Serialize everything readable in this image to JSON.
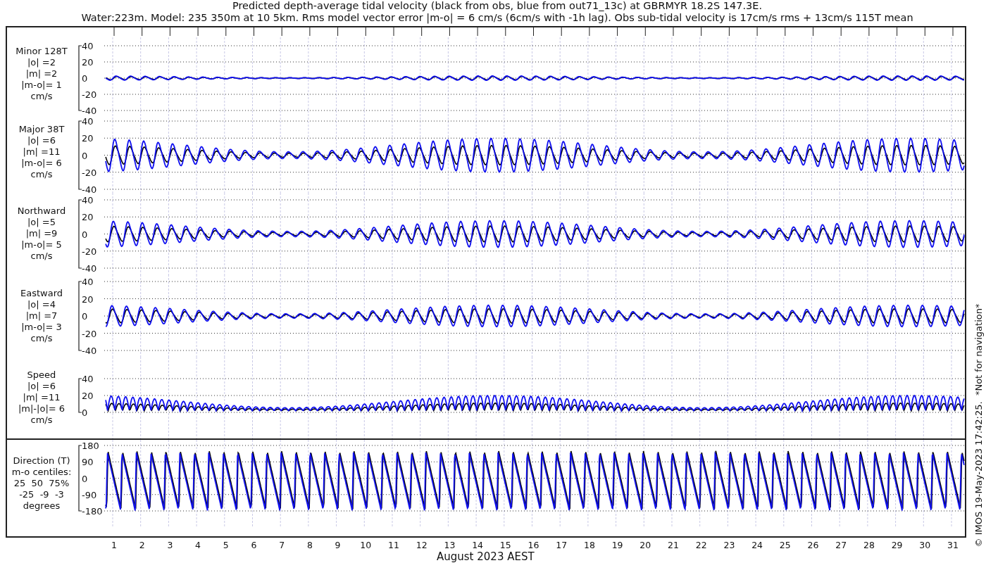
{
  "title_lines": [
    "Predicted depth-average tidal velocity (black from obs, blue from out71_13c) at GBRMYR 18.2S 147.3E.",
    "Water:223m. Model: 235 350m at 10 5km. Rms model vector error |m-o| = 6 cm/s (6cm/s with -1h lag). Obs sub-tidal velocity is 17cm/s rms + 13cm/s 115T mean"
  ],
  "panels": [
    {
      "kind": "velocity",
      "label_lines": [
        "Minor 128T",
        "|o| =2",
        "|m| =2",
        "|m-o|= 1",
        "cm/s"
      ],
      "yticks": [
        "40",
        "20",
        "0",
        "-20",
        "-40"
      ]
    },
    {
      "kind": "velocity",
      "label_lines": [
        "Major 38T",
        "|o| =6",
        "|m| =11",
        "|m-o|= 6",
        "cm/s"
      ],
      "yticks": [
        "40",
        "20",
        "0",
        "-20",
        "-40"
      ]
    },
    {
      "kind": "velocity",
      "label_lines": [
        "Northward",
        "|o| =5",
        "|m| =9",
        "|m-o|= 5",
        "cm/s"
      ],
      "yticks": [
        "40",
        "20",
        "0",
        "-20",
        "-40"
      ]
    },
    {
      "kind": "velocity",
      "label_lines": [
        "Eastward",
        "|o| =4",
        "|m| =7",
        "|m-o|= 3",
        "cm/s"
      ],
      "yticks": [
        "40",
        "20",
        "0",
        "-20",
        "-40"
      ]
    },
    {
      "kind": "speed",
      "label_lines": [
        "Speed",
        "|o| =6",
        "|m| =11",
        "|m|-|o|= 6",
        "cm/s"
      ],
      "yticks": [
        "40",
        "20",
        "0"
      ]
    },
    {
      "kind": "direction",
      "label_lines": [
        "Direction (T)",
        "m-o centiles:",
        "25  50  75%",
        "-25  -9  -3",
        "degrees"
      ],
      "yticks": [
        "180",
        "90",
        "0",
        "-90",
        "-180"
      ]
    }
  ],
  "x_axis": {
    "ticks": [
      "1",
      "2",
      "3",
      "4",
      "5",
      "6",
      "7",
      "8",
      "9",
      "10",
      "11",
      "12",
      "13",
      "14",
      "15",
      "16",
      "17",
      "18",
      "19",
      "20",
      "21",
      "22",
      "23",
      "24",
      "25",
      "26",
      "27",
      "28",
      "29",
      "30",
      "31"
    ],
    "label": "August 2023 AEST"
  },
  "credit": "© IMOS 19-May-2023 17:42:25.  *Not for navigation*"
}
